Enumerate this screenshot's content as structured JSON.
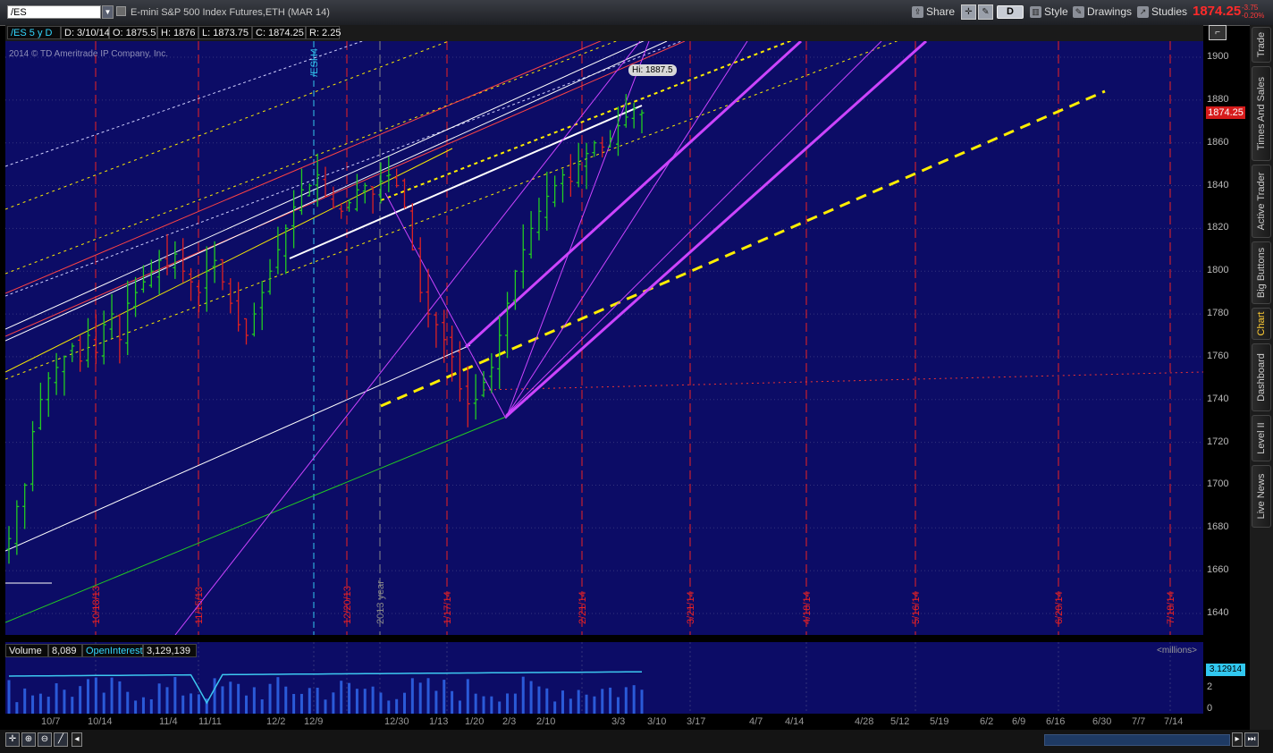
{
  "header": {
    "symbol": "/ES",
    "description": "E-mini S&P 500 Index Futures,ETH (MAR 14)",
    "share_label": "Share",
    "period_label": "D",
    "style_label": "Style",
    "drawings_label": "Drawings",
    "studies_label": "Studies",
    "last_price": "1874.25",
    "net_change": "-3.75",
    "pct_change": "-0.20%"
  },
  "info_bar": {
    "symbol": "/ES 5 y D",
    "date": "D: 3/10/14",
    "open": "O: 1875.5",
    "high": "H: 1876",
    "low": "L: 1873.75",
    "close": "C: 1874.25",
    "range": "R: 2.25"
  },
  "watermark": "2014 © TD Ameritrade IP Company, Inc.",
  "hi_label": "Hi: 1887.5",
  "price_tag": "1874.25",
  "y_ticks": [
    "1900",
    "1880",
    "1860",
    "1840",
    "1820",
    "1800",
    "1780",
    "1760",
    "1740",
    "1720",
    "1700",
    "1680",
    "1660",
    "1640"
  ],
  "volume_panel": {
    "volume_label": "Volume",
    "volume_value": "8,089",
    "oi_label": "OpenInterest",
    "oi_value": "3,129,139",
    "units": "<millions>",
    "oi_tag": "3.12914",
    "y_ticks": [
      "2",
      "0"
    ]
  },
  "x_ticks": [
    "10/7",
    "10/14",
    "11/4",
    "11/11",
    "12/2",
    "12/9",
    "12/30",
    "1/13",
    "1/20",
    "2/3",
    "2/10",
    "3/3",
    "3/10",
    "3/17",
    "4/7",
    "4/14",
    "4/28",
    "5/12",
    "5/19",
    "6/2",
    "6/9",
    "6/16",
    "6/30",
    "7/7",
    "7/14"
  ],
  "vertical_markers": [
    "10/18/13",
    "11/15/13",
    "/ESH4",
    "12/20/13",
    "2013 year",
    "1/17/14",
    "2/21/14",
    "3/21/14",
    "4/18/14",
    "5/16/14",
    "6/20/14",
    "7/18/14"
  ],
  "sidebar_tabs": [
    "Trade",
    "Times And Sales",
    "Active Trader",
    "Big Buttons",
    "Chart",
    "Dashboard",
    "Level II",
    "Live News"
  ],
  "colors": {
    "background": "#0c0c66",
    "up_bar": "#22cc22",
    "down_bar": "#dd2222",
    "volume_bar": "#2a5ad8",
    "oi_line": "#3dc8f0",
    "purple": "#cc44ff",
    "yellow": "#ffee00",
    "red_marker": "#ee2222",
    "price_tag": "#d61b1b"
  }
}
